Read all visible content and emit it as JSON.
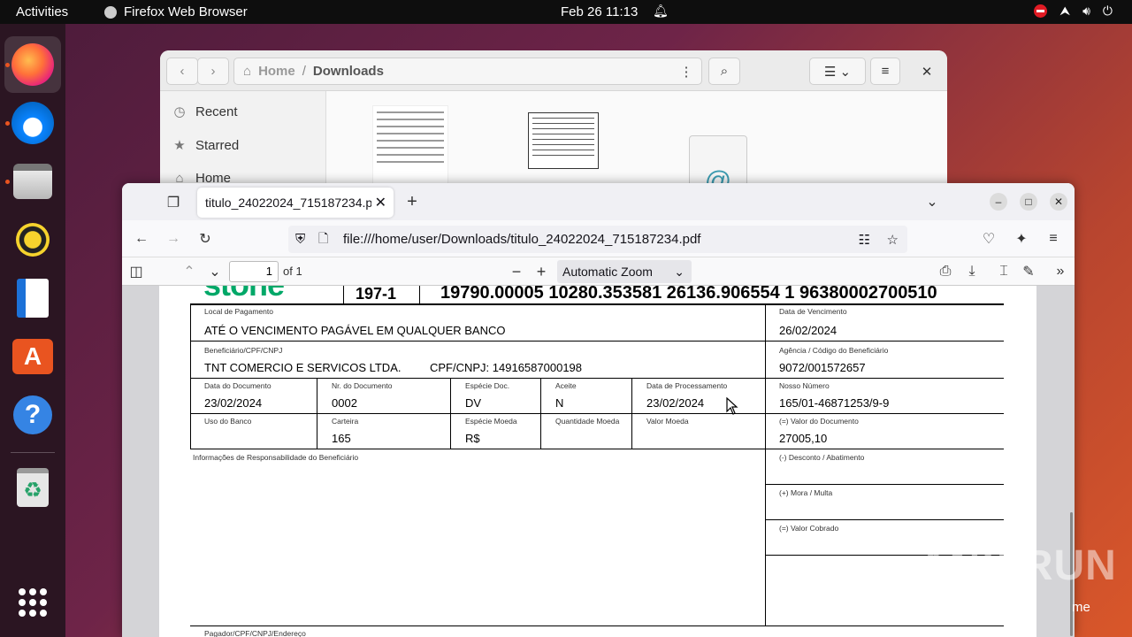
{
  "topbar": {
    "activities": "Activities",
    "app_name": "Firefox Web Browser",
    "clock": "Feb 26  11:13"
  },
  "dock": {
    "items": [
      "Firefox",
      "Thunderbird",
      "Files",
      "Rhythmbox",
      "LibreOffice Writer",
      "Ubuntu Software",
      "Help",
      "Trash"
    ]
  },
  "files": {
    "path_home": "Home",
    "path_sep": "/",
    "path_current": "Downloads",
    "sidebar": [
      {
        "icon": "clock-icon",
        "label": "Recent"
      },
      {
        "icon": "star-icon",
        "label": "Starred"
      },
      {
        "icon": "home-icon",
        "label": "Home"
      }
    ],
    "partial_label": "me"
  },
  "firefox": {
    "tab_title": "titulo_24022024_715187234.pdf",
    "url": "file:///home/user/Downloads/titulo_24022024_715187234.pdf",
    "pdf": {
      "page_number": "1",
      "page_count": "of 1",
      "zoom": "Automatic Zoom"
    }
  },
  "boleto": {
    "logo": "stone",
    "bank_code": "197-1",
    "digitable_line": "19790.00005  10280.353581  26136.906554  1  96380002700510",
    "local_pagamento_label": "Local de Pagamento",
    "local_pagamento": "ATÉ O VENCIMENTO PAGÁVEL EM QUALQUER BANCO",
    "vencimento_label": "Data de Vencimento",
    "vencimento": "26/02/2024",
    "beneficiario_label": "Beneficiário/CPF/CNPJ",
    "beneficiario": "TNT COMERCIO E SERVICOS LTDA.",
    "cnpj": "CPF/CNPJ: 14916587000198",
    "agencia_label": "Agência / Código do Beneficiário",
    "agencia": "9072/001572657",
    "data_doc_label": "Data do Documento",
    "data_doc": "23/02/2024",
    "nr_doc_label": "Nr. do Documento",
    "nr_doc": "0002",
    "especie_doc_label": "Espécie Doc.",
    "especie_doc": "DV",
    "aceite_label": "Aceite",
    "aceite": "N",
    "data_proc_label": "Data de Processamento",
    "data_proc": "23/02/2024",
    "nosso_numero_label": "Nosso Número",
    "nosso_numero": "165/01-46871253/9-9",
    "uso_banco_label": "Uso do Banco",
    "carteira_label": "Carteira",
    "carteira": "165",
    "especie_moeda_label": "Espécie Moeda",
    "especie_moeda": "R$",
    "qtd_moeda_label": "Quantidade Moeda",
    "valor_moeda_label": "Valor Moeda",
    "valor_doc_label": "(=) Valor do Documento",
    "valor_doc": "27005,10",
    "info_label": "Informações de Responsabilidade do Beneficiário",
    "desconto_label": "(-) Desconto / Abatimento",
    "mora_label": "(+) Mora / Multa",
    "cobrado_label": "(=) Valor Cobrado",
    "pagador_label": "Pagador/CPF/CNPJ/Endereço"
  },
  "watermark": "ANY RUN"
}
